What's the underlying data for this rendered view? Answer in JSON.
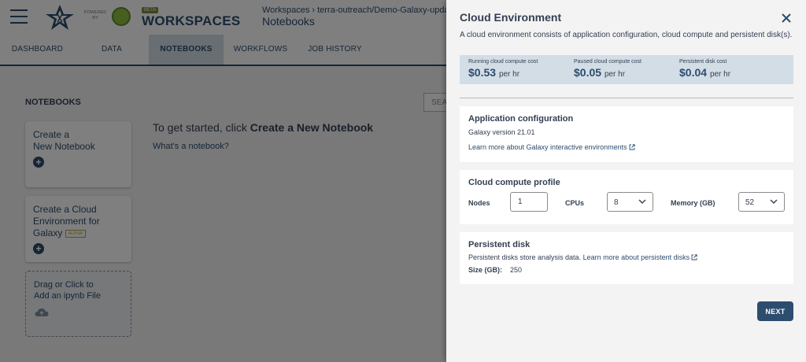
{
  "app": {
    "powered_by": "POWERED BY",
    "beta": "BETA",
    "brand": "WORKSPACES",
    "breadcrumb": "Workspaces › terra-outreach/Demo-Galaxy-upda",
    "page_title": "Notebooks"
  },
  "tabs": [
    {
      "label": "DASHBOARD"
    },
    {
      "label": "DATA"
    },
    {
      "label": "NOTEBOOKS",
      "active": true
    },
    {
      "label": "WORKFLOWS"
    },
    {
      "label": "JOB HISTORY"
    }
  ],
  "notebooks": {
    "heading": "NOTEBOOKS",
    "search_placeholder": "SEA",
    "create_notebook": {
      "line1": "Create a",
      "line2": "New Notebook"
    },
    "create_galaxy": {
      "line1": "Create a Cloud",
      "line2": "Environment for",
      "line3": "Galaxy",
      "tag": "ALPHA"
    },
    "upload": {
      "line1": "Drag or Click to",
      "line2": "Add an ipynb File"
    },
    "get_started_prefix": "To get started, click ",
    "get_started_strong": "Create a New Notebook",
    "whats_notebook": "What's a notebook?"
  },
  "panel": {
    "title": "Cloud Environment",
    "description": "A cloud environment consists of application configuration, cloud compute and persistent disk(s).",
    "costs": [
      {
        "label": "Running cloud compute cost",
        "value": "$0.53",
        "unit": "per hr"
      },
      {
        "label": "Paused cloud compute cost",
        "value": "$0.05",
        "unit": "per hr"
      },
      {
        "label": "Persistent disk cost",
        "value": "$0.04",
        "unit": "per hr"
      }
    ],
    "app_config": {
      "title": "Application configuration",
      "version": "Galaxy version 21.01",
      "link": "Learn more about Galaxy interactive environments"
    },
    "compute": {
      "title": "Cloud compute profile",
      "nodes_label": "Nodes",
      "nodes_value": "1",
      "cpus_label": "CPUs",
      "cpus_value": "8",
      "memory_label": "Memory (GB)",
      "memory_value": "52"
    },
    "disk": {
      "title": "Persistent disk",
      "description": "Persistent disks store analysis data.",
      "link": "Learn more about persistent disks",
      "size_label": "Size (GB):",
      "size_value": "250"
    },
    "next_label": "NEXT"
  },
  "colors": {
    "brand_navy": "#2c4d6e",
    "cost_bar_bg": "#d3dde6",
    "panel_bg": "#f3f3f3"
  }
}
